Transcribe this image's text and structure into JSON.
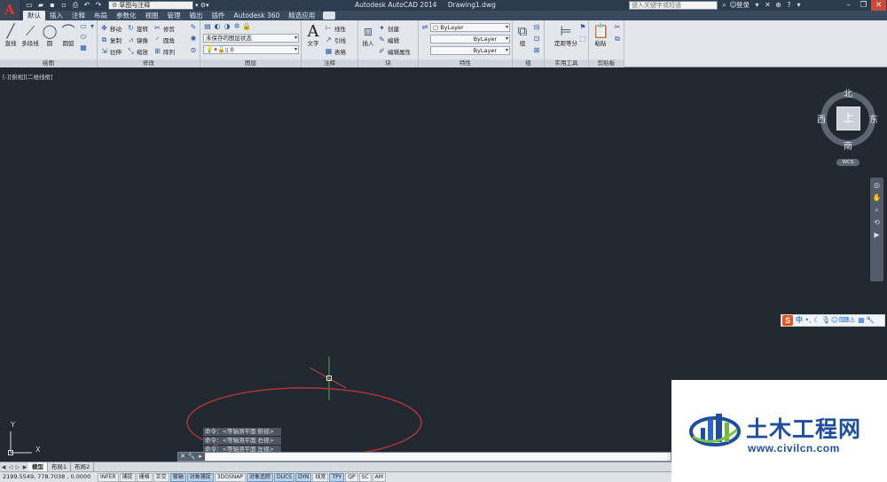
{
  "titlebar": {
    "app_logo": "A",
    "quick_access_icons": [
      "new-icon",
      "open-icon",
      "save-icon",
      "save-as-icon",
      "print-icon",
      "undo-icon",
      "redo-icon"
    ],
    "workspace": "草图与注释",
    "document_title": [
      "Autodesk AutoCAD 2014",
      "Drawing1.dwg"
    ],
    "search_placeholder": "键入关键字或短语",
    "login_label": "登录",
    "window_controls": [
      "minimize",
      "restore",
      "close"
    ]
  },
  "ribbon": {
    "tabs": [
      "默认",
      "插入",
      "注释",
      "布局",
      "参数化",
      "视图",
      "管理",
      "输出",
      "插件",
      "Autodesk 360",
      "精选应用"
    ],
    "active_tab": "默认",
    "panels": {
      "draw": {
        "title": "绘图",
        "buttons": [
          "直线",
          "多段线",
          "圆",
          "圆弧"
        ]
      },
      "modify": {
        "title": "修改",
        "items": [
          "移动",
          "旋转",
          "修剪",
          "复制",
          "镜像",
          "圆角",
          "拉伸",
          "缩放",
          "阵列"
        ]
      },
      "layers": {
        "title": "图层",
        "layer_state": "未保存的图层状态",
        "current_layer": "0"
      },
      "annotation": {
        "title": "注释",
        "text_button": "文字",
        "items": [
          "线性",
          "引线",
          "表格"
        ]
      },
      "block": {
        "title": "块",
        "insert_button": "插入",
        "items": [
          "创建",
          "编辑",
          "编辑属性"
        ]
      },
      "properties": {
        "title": "特性",
        "color": "ByLayer",
        "linetype": "ByLayer",
        "lineweight": "ByLayer"
      },
      "groups": {
        "title": "组",
        "button": "组"
      },
      "utilities": {
        "title": "实用工具",
        "button": "定距等分"
      },
      "clipboard": {
        "title": "剪贴板",
        "button": "粘贴"
      }
    }
  },
  "viewport": {
    "label": "[-][俯视][二维线框]",
    "viewcube": {
      "north": "北",
      "south": "南",
      "east": "东",
      "west": "西",
      "face": "上",
      "wcs": "WCS"
    },
    "ucs_y": "Y",
    "ucs_x": "X"
  },
  "navbar_icons": [
    "steering-wheel-icon",
    "pan-icon",
    "zoom-icon",
    "orbit-icon",
    "showmotion-icon"
  ],
  "ime_toolbar": {
    "logo": "S",
    "mode": "中",
    "icons": [
      "punctuation-icon",
      "moon-icon",
      "mic-icon",
      "emoji-icon",
      "keyboard-icon",
      "shirt-icon",
      "grid-icon",
      "wrench-icon"
    ]
  },
  "command_history": [
    "命令：<等轴测平面 俯视>",
    "命令：<等轴测平面 右视>",
    "命令：<等轴测平面 左视>"
  ],
  "command_line": {
    "prompt_icon": "▸",
    "input_value": ""
  },
  "layout_tabs": [
    "模型",
    "布局1",
    "布局2"
  ],
  "active_layout": "模型",
  "statusbar": {
    "coordinates": "2199.5549, 778.7038 , 0.0000",
    "toggles": [
      {
        "label": "INFER",
        "on": false
      },
      {
        "label": "捕捉",
        "on": false
      },
      {
        "label": "栅格",
        "on": false
      },
      {
        "label": "正交",
        "on": false
      },
      {
        "label": "极轴",
        "on": true
      },
      {
        "label": "对象捕捉",
        "on": true
      },
      {
        "label": "3DOSNAP",
        "on": false
      },
      {
        "label": "对象追踪",
        "on": true
      },
      {
        "label": "DUCS",
        "on": true
      },
      {
        "label": "DYN",
        "on": true
      },
      {
        "label": "线宽",
        "on": false
      },
      {
        "label": "TPY",
        "on": true
      },
      {
        "label": "QP",
        "on": false
      },
      {
        "label": "SC",
        "on": false
      },
      {
        "label": "AM",
        "on": false
      }
    ]
  },
  "watermark": {
    "name": "土木工程网",
    "url": "www.civilcn.com"
  },
  "colors": {
    "canvas": "#212830",
    "crosshair_x": "#c94a4a",
    "crosshair_y": "#4caf50",
    "annotation_ellipse": "#b8343a",
    "watermark_blue": "#1f4f9c"
  }
}
